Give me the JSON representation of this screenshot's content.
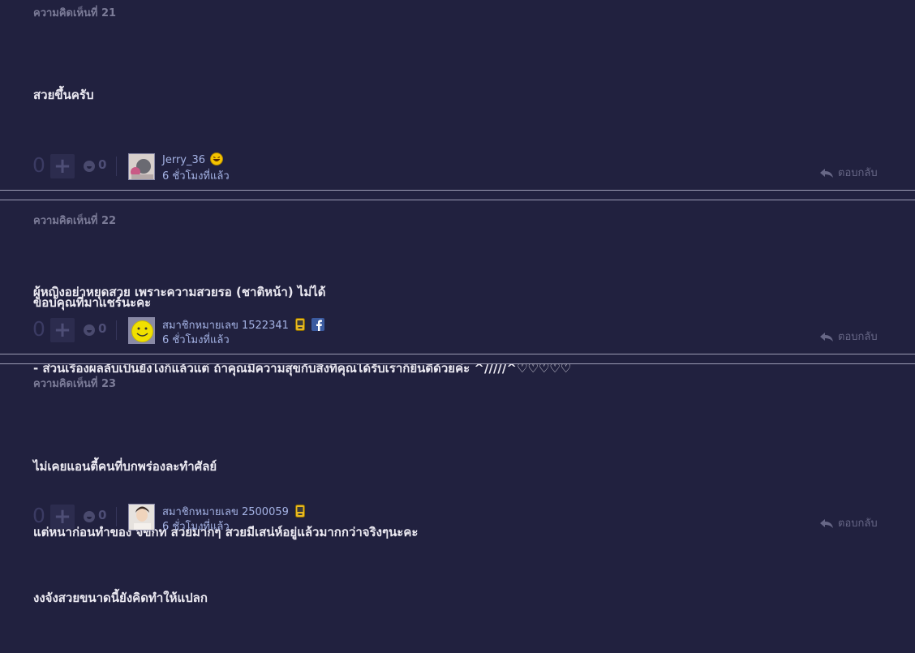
{
  "comments": [
    {
      "label": "ความคิดเห็นที่ 21",
      "body": [
        "สวยขึ้นครับ",
        "",
        "",
        "ผู้หญิงอย่าหยุดสวย เพราะความสวยรอ (ชาติหน้า) ไม่ได้"
      ],
      "votes": "0",
      "emotions": "0",
      "user": "Jerry_36",
      "time": "6 ชั่วโมงที่แล้ว",
      "reply": "ตอบกลับ",
      "badges": [
        "laugh-emoji-icon"
      ]
    },
    {
      "label": "ความคิดเห็นที่ 22",
      "body": [
        "ขอบคุณที่มาแชร์นะคะ",
        "- ส่วนเรื่องผลลับเป็นยังไงก็แล้วแต่ ถ้าคุณมีความสุขกับสิ่งที่คุณได้รับเราก็ยินดีด้วยค่ะ ^/////^♡♡♡♡♡"
      ],
      "votes": "0",
      "emotions": "0",
      "user": "สมาชิกหมายเลข 1522341",
      "time": "6 ชั่วโมงที่แล้ว",
      "reply": "ตอบกลับ",
      "badges": [
        "mobile-verified-icon",
        "facebook-icon"
      ]
    },
    {
      "label": "ความคิดเห็นที่ 23",
      "body": [
        "ไม่เคยแอนตี้คนที่บกพร่องละทำศัลย์",
        "แต่หน้าก่อนทำของ จขกท สวยมากๆ สวยมีเสน่ห์อยู่แล้วมากกว่าจริงๆนะคะ",
        "งงจังสวยขนาดนี้ยังคิดทำให้แปลก"
      ],
      "votes": "0",
      "emotions": "0",
      "user": "สมาชิกหมายเลข 2500059",
      "time": "6 ชั่วโมงที่แล้ว",
      "reply": "ตอบกลับ",
      "badges": [
        "mobile-verified-icon"
      ]
    }
  ],
  "colors": {
    "background": "#21213f",
    "link": "#a4b2e4",
    "muted": "#7c7c98"
  }
}
